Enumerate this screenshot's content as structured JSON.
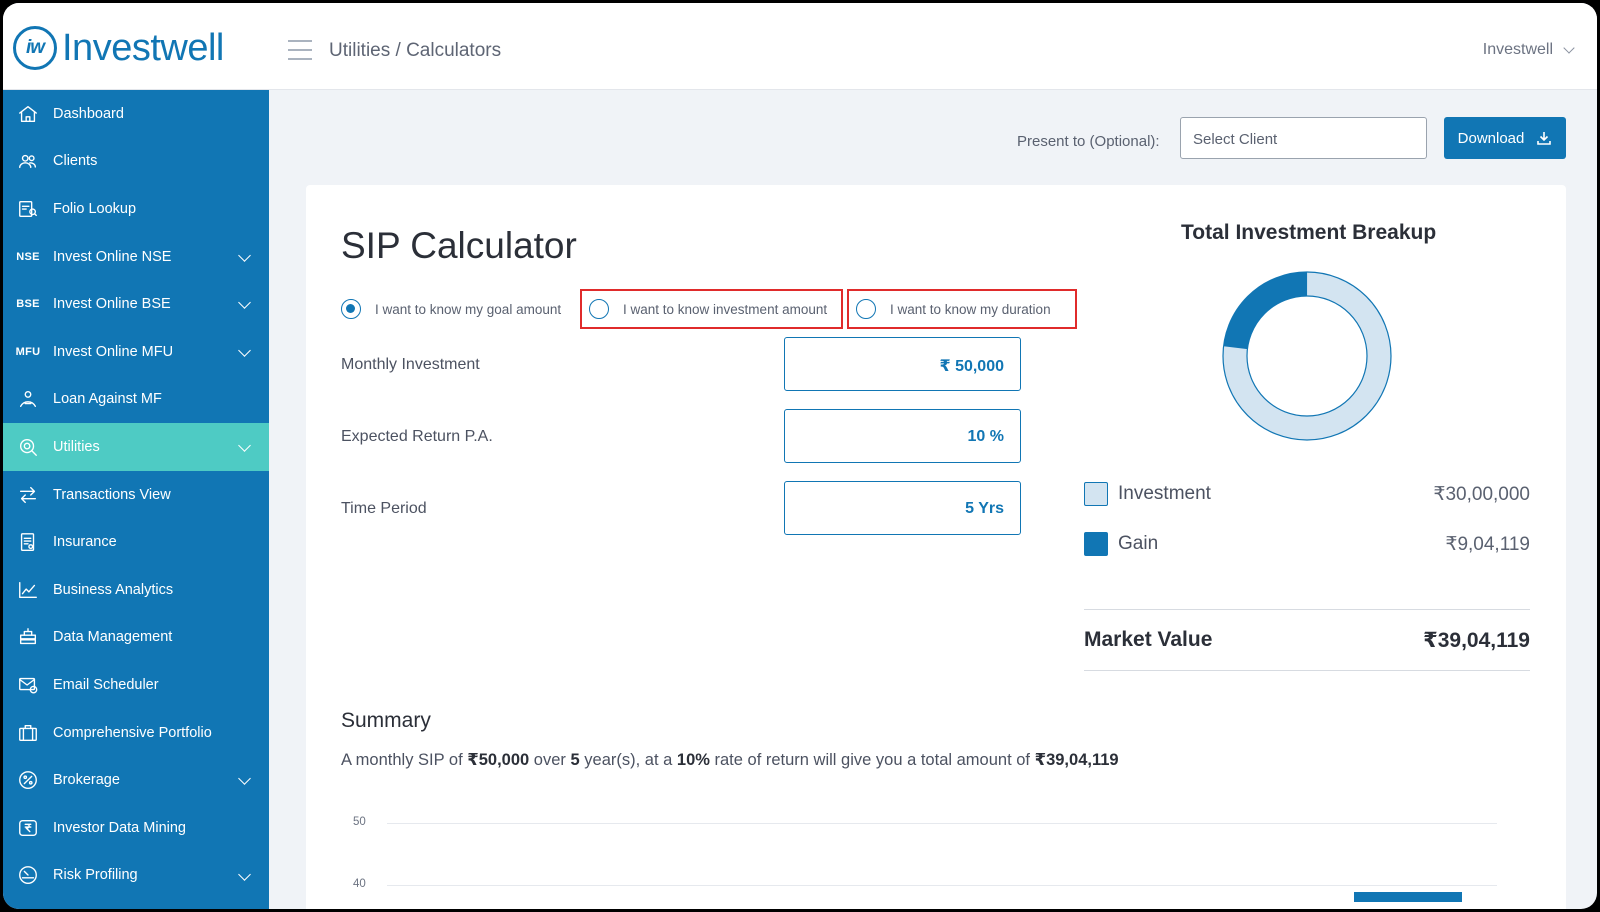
{
  "app": {
    "logo_text": "Investwell",
    "logo_mark": "iw",
    "breadcrumb": "Utilities / Calculators",
    "user_menu": "Investwell"
  },
  "sidebar": {
    "items": [
      {
        "label": "Dashboard",
        "icon": "home-icon",
        "has_chevron": false,
        "active": false
      },
      {
        "label": "Clients",
        "icon": "users-icon",
        "has_chevron": false,
        "active": false
      },
      {
        "label": "Folio Lookup",
        "icon": "folio-icon",
        "has_chevron": false,
        "active": false
      },
      {
        "label": "Invest Online NSE",
        "icon": "nse-icon",
        "icon_text": "NSE",
        "has_chevron": true,
        "active": false
      },
      {
        "label": "Invest Online BSE",
        "icon": "bse-icon",
        "icon_text": "BSE",
        "has_chevron": true,
        "active": false
      },
      {
        "label": "Invest Online MFU",
        "icon": "mfu-icon",
        "icon_text": "MFU",
        "has_chevron": true,
        "active": false
      },
      {
        "label": "Loan Against MF",
        "icon": "loan-icon",
        "has_chevron": false,
        "active": false
      },
      {
        "label": "Utilities",
        "icon": "utilities-icon",
        "has_chevron": true,
        "active": true
      },
      {
        "label": "Transactions View",
        "icon": "transactions-icon",
        "has_chevron": false,
        "active": false
      },
      {
        "label": "Insurance",
        "icon": "insurance-icon",
        "has_chevron": false,
        "active": false
      },
      {
        "label": "Business Analytics",
        "icon": "analytics-icon",
        "has_chevron": false,
        "active": false
      },
      {
        "label": "Data Management",
        "icon": "data-icon",
        "has_chevron": false,
        "active": false
      },
      {
        "label": "Email Scheduler",
        "icon": "email-icon",
        "has_chevron": false,
        "active": false
      },
      {
        "label": "Comprehensive Portfolio",
        "icon": "portfolio-icon",
        "has_chevron": false,
        "active": false
      },
      {
        "label": "Brokerage",
        "icon": "brokerage-icon",
        "has_chevron": true,
        "active": false
      },
      {
        "label": "Investor Data Mining",
        "icon": "rupee-icon",
        "has_chevron": false,
        "active": false
      },
      {
        "label": "Risk Profiling",
        "icon": "gauge-icon",
        "has_chevron": true,
        "active": false
      }
    ]
  },
  "toolbar": {
    "present_label": "Present to (Optional):",
    "client_placeholder": "Select Client",
    "download_label": "Download"
  },
  "calculator": {
    "title": "SIP Calculator",
    "options": [
      {
        "label": "I want to know my goal amount",
        "checked": true
      },
      {
        "label": "I want to know investment amount",
        "checked": false
      },
      {
        "label": "I want to know my duration",
        "checked": false
      }
    ],
    "fields": [
      {
        "label": "Monthly Investment",
        "value": "₹ 50,000"
      },
      {
        "label": "Expected Return P.A.",
        "value": "10 %"
      },
      {
        "label": "Time Period",
        "value": "5 Yrs"
      }
    ]
  },
  "breakup": {
    "title": "Total Investment Breakup",
    "investment_label": "Investment",
    "investment_value": "₹30,00,000",
    "gain_label": "Gain",
    "gain_value": "₹9,04,119",
    "market_value_label": "Market Value",
    "market_value": "₹39,04,119",
    "investment_color": "#d3e4f1",
    "gain_color": "#1176b4",
    "gain_fraction": 0.2316
  },
  "summary": {
    "title": "Summary",
    "text_1": "A monthly SIP of ",
    "amount": "₹50,000",
    "text_2": " over ",
    "years": "5",
    "text_3": " year(s), at a ",
    "rate": "10%",
    "text_4": " rate of return will give you a total amount of ",
    "total": "₹39,04,119"
  },
  "chart_data": {
    "type": "bar",
    "y_ticks": [
      "50",
      "40"
    ]
  },
  "colors": {
    "brand": "#1176b4",
    "active_nav": "#4ecbc4",
    "highlight": "#e02b2b"
  }
}
